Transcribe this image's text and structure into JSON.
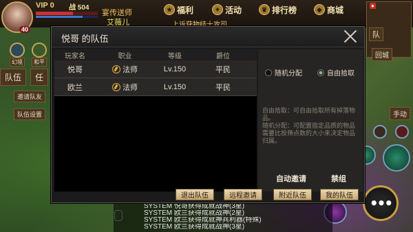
{
  "hud": {
    "vip": "VIP 0",
    "power": "战 504",
    "level": "40",
    "npc_title": "宴传送师",
    "npc_name": "艾薇儿",
    "menu": [
      "福利",
      "活动",
      "排行榜",
      "商城"
    ],
    "marquee": "上诉获物结十攻司",
    "left_buttons": [
      "队伍",
      "任",
      "邀请队友",
      "队伍设置"
    ],
    "right_labels": [
      "队",
      "回城",
      "手动"
    ],
    "left_labels": [
      "幻境",
      "和平"
    ]
  },
  "dialog": {
    "title": "悦哥 的队伍",
    "columns": [
      "玩家名",
      "职业",
      "等级",
      "爵位"
    ],
    "members": [
      {
        "name": "悦哥",
        "class": "法师",
        "level": "Lv.150",
        "rank": "平民"
      },
      {
        "name": "欧兰",
        "class": "法师",
        "level": "Lv.150",
        "rank": "平民"
      }
    ],
    "distribution": {
      "random_label": "随机分配",
      "free_label": "自由拾取",
      "selected": "free"
    },
    "description": [
      "自由拾取：可自由拾取所有掉落物品。",
      "随机分配：可配置指定品质的物品需要比投筛点数的大小来决定物品归属。"
    ],
    "auto_invite": "自动邀请",
    "forbid": "禁组",
    "buttons": [
      "退出队伍",
      "远程邀请",
      "附近队伍",
      "我的队伍"
    ]
  },
  "chat": {
    "lines": [
      "SYSTEM 悦哥获得成就战神(3星)",
      "SYSTEM 欧兰获得成就战神(2星)",
      "SYSTEM 欧兰获得成就神兵利器(特殊)",
      "SYSTEM 欧兰获得成就战神(3星)"
    ]
  }
}
